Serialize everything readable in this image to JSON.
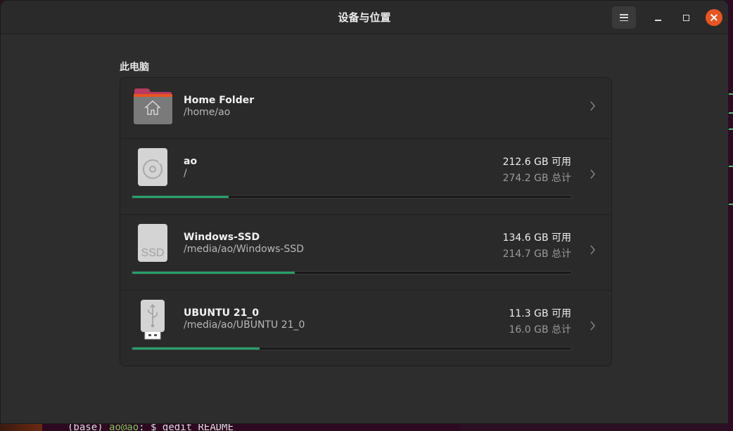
{
  "window": {
    "title": "设备与位置"
  },
  "section": {
    "title": "此电脑"
  },
  "locations": [
    {
      "name": "Home Folder",
      "path": "/home/ao",
      "icon": "home-folder-icon"
    },
    {
      "name": "ao",
      "path": "/",
      "available": "212.6 GB 可用",
      "total": "274.2 GB 总计",
      "usage_fraction": 0.22,
      "icon": "hard-disk-icon"
    },
    {
      "name": "Windows-SSD",
      "path": "/media/ao/Windows-SSD",
      "available": "134.6 GB 可用",
      "total": "214.7 GB 总计",
      "usage_fraction": 0.37,
      "icon": "ssd-icon",
      "icon_text": "SSD"
    },
    {
      "name": "UBUNTU 21_0",
      "path": "/media/ao/UBUNTU 21_0",
      "available": "11.3 GB 可用",
      "total": "16.0 GB 总计",
      "usage_fraction": 0.29,
      "icon": "usb-drive-icon"
    }
  ],
  "terminal": {
    "prompt_prefix": "(base) ",
    "user": "ao@ao",
    "rest": ": $ gedit README"
  },
  "colors": {
    "accent": "#e95420",
    "usage_bar": "#26a269"
  }
}
